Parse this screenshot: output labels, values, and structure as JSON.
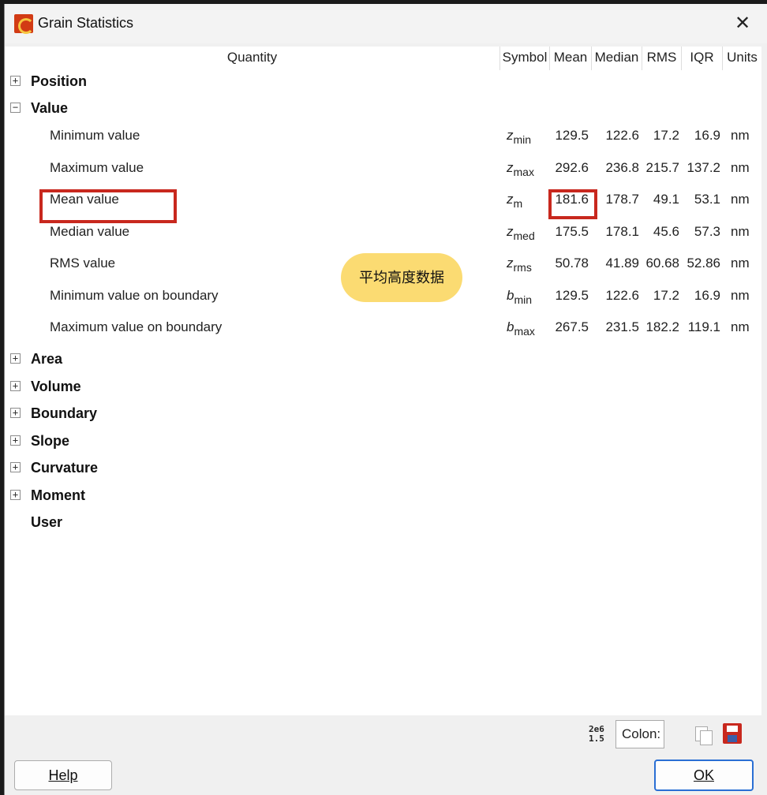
{
  "window": {
    "title": "Grain Statistics",
    "close_glyph": "✕"
  },
  "columns": {
    "quantity": "Quantity",
    "symbol": "Symbol",
    "mean": "Mean",
    "median": "Median",
    "rms": "RMS",
    "iqr": "IQR",
    "units": "Units"
  },
  "groups_top": [
    {
      "label": "Position",
      "toggle": "+"
    },
    {
      "label": "Value",
      "toggle": "−"
    }
  ],
  "value_rows": [
    {
      "name": "Minimum value",
      "sym": "z",
      "sub": "min",
      "mean": "129.5",
      "median": "122.6",
      "rms": "17.2",
      "iqr": "16.9",
      "units": "nm"
    },
    {
      "name": "Maximum value",
      "sym": "z",
      "sub": "max",
      "mean": "292.6",
      "median": "236.8",
      "rms": "215.7",
      "iqr": "137.2",
      "units": "nm"
    },
    {
      "name": "Mean value",
      "sym": "z",
      "sub": "m",
      "mean": "181.6",
      "median": "178.7",
      "rms": "49.1",
      "iqr": "53.1",
      "units": "nm"
    },
    {
      "name": "Median value",
      "sym": "z",
      "sub": "med",
      "mean": "175.5",
      "median": "178.1",
      "rms": "45.6",
      "iqr": "57.3",
      "units": "nm"
    },
    {
      "name": "RMS value",
      "sym": "z",
      "sub": "rms",
      "mean": "50.78",
      "median": "41.89",
      "rms": "60.68",
      "iqr": "52.86",
      "units": "nm"
    },
    {
      "name": "Minimum value on boundary",
      "sym": "b",
      "sub": "min",
      "mean": "129.5",
      "median": "122.6",
      "rms": "17.2",
      "iqr": "16.9",
      "units": "nm"
    },
    {
      "name": "Maximum value on boundary",
      "sym": "b",
      "sub": "max",
      "mean": "267.5",
      "median": "231.5",
      "rms": "182.2",
      "iqr": "119.1",
      "units": "nm"
    }
  ],
  "groups_bottom": [
    {
      "label": "Area",
      "toggle": "+"
    },
    {
      "label": "Volume",
      "toggle": "+"
    },
    {
      "label": "Boundary",
      "toggle": "+"
    },
    {
      "label": "Slope",
      "toggle": "+"
    },
    {
      "label": "Curvature",
      "toggle": "+"
    },
    {
      "label": "Moment",
      "toggle": "+"
    },
    {
      "label": "User",
      "toggle": ""
    }
  ],
  "annotation": {
    "callout_text": "平均高度数据",
    "highlight_color": "#c8281e",
    "callout_color": "#fbdb72"
  },
  "toolbar": {
    "format_icon_text": "2e6\n1.5",
    "separator_value": "Colon:"
  },
  "buttons": {
    "help_label": "Help",
    "ok_label": "OK"
  }
}
